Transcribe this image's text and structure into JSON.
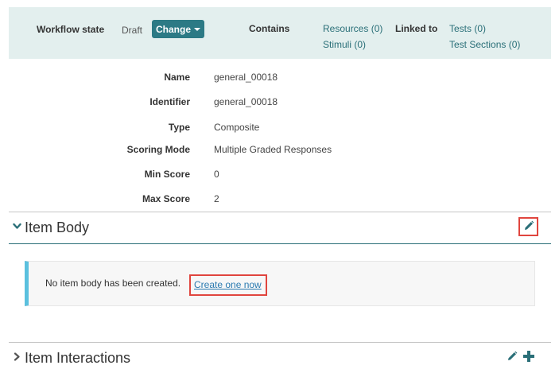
{
  "workflow": {
    "state_label": "Workflow state",
    "state_value": "Draft",
    "change_button": "Change",
    "contains_label": "Contains",
    "contains_links": [
      "Resources (0)",
      "Stimuli (0)"
    ],
    "linked_label": "Linked to",
    "linked_links": [
      "Tests (0)",
      "Test Sections (0)"
    ]
  },
  "properties": [
    {
      "label": "Name",
      "value": "general_00018"
    },
    {
      "label": "Identifier",
      "value": "general_00018"
    },
    {
      "label": "Type",
      "value": "Composite"
    },
    {
      "label": "Scoring Mode",
      "value": "Multiple Graded Responses"
    },
    {
      "label": "Min Score",
      "value": "0"
    },
    {
      "label": "Max Score",
      "value": "2"
    }
  ],
  "item_body": {
    "title": "Item Body",
    "message": "No item body has been created.",
    "create_link": "Create one now"
  },
  "item_interactions": {
    "title": "Item Interactions"
  },
  "icons": {
    "edit": "pencil-icon",
    "add": "plus-icon",
    "expanded": "chevron-down-icon",
    "collapsed": "chevron-right-icon"
  },
  "colors": {
    "accent": "#2c7a85",
    "link": "#2a6f78",
    "highlight": "#e0453e",
    "info_border": "#5bc0de",
    "topbar_bg": "#e3efee"
  }
}
